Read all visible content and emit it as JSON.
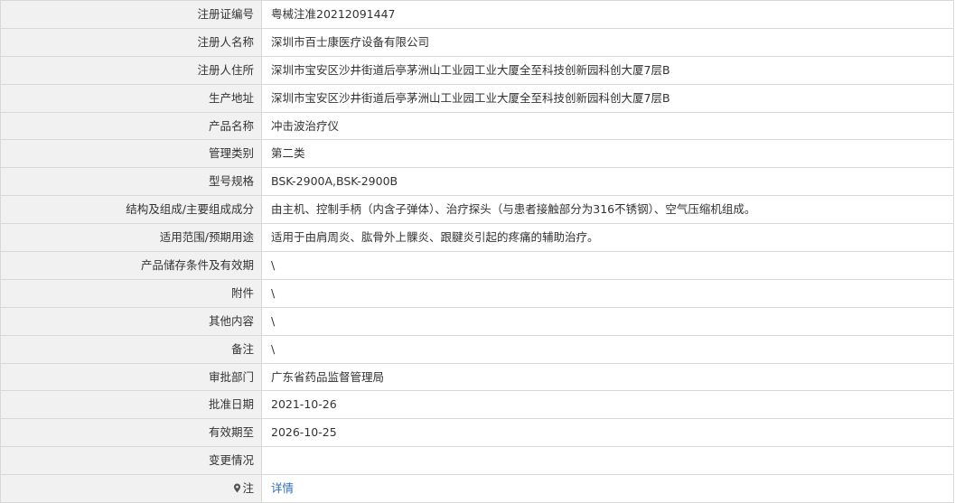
{
  "rows": [
    {
      "label": "注册证编号",
      "value": "粤械注准20212091447"
    },
    {
      "label": "注册人名称",
      "value": "深圳市百士康医疗设备有限公司"
    },
    {
      "label": "注册人住所",
      "value": "深圳市宝安区沙井街道后亭茅洲山工业园工业大厦全至科技创新园科创大厦7层B"
    },
    {
      "label": "生产地址",
      "value": "深圳市宝安区沙井街道后亭茅洲山工业园工业大厦全至科技创新园科创大厦7层B"
    },
    {
      "label": "产品名称",
      "value": "冲击波治疗仪"
    },
    {
      "label": "管理类别",
      "value": "第二类"
    },
    {
      "label": "型号规格",
      "value": "BSK-2900A,BSK-2900B"
    },
    {
      "label": "结构及组成/主要组成成分",
      "value": "由主机、控制手柄（内含子弹体）、治疗探头（与患者接触部分为316不锈钢）、空气压缩机组成。"
    },
    {
      "label": "适用范围/预期用途",
      "value": "适用于由肩周炎、肱骨外上髁炎、跟腱炎引起的疼痛的辅助治疗。"
    },
    {
      "label": "产品储存条件及有效期",
      "value": "\\"
    },
    {
      "label": "附件",
      "value": "\\"
    },
    {
      "label": "其他内容",
      "value": "\\"
    },
    {
      "label": "备注",
      "value": "\\"
    },
    {
      "label": "审批部门",
      "value": "广东省药品监督管理局"
    },
    {
      "label": "批准日期",
      "value": "2021-10-26"
    },
    {
      "label": "有效期至",
      "value": "2026-10-25"
    },
    {
      "label": "变更情况",
      "value": ""
    }
  ],
  "note": {
    "label": "注",
    "link_text": "详情",
    "icon": "pin-icon",
    "link_color": "#2f6fb5"
  }
}
